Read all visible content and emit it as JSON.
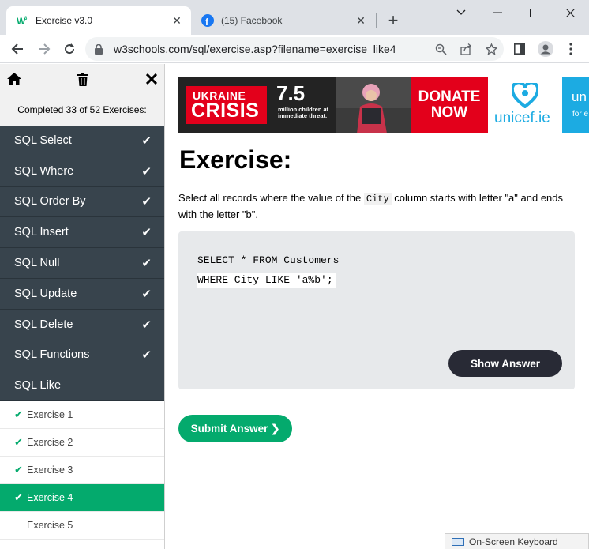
{
  "browser": {
    "tabs": [
      {
        "title": "Exercise v3.0",
        "favicon": "w3schools-icon",
        "active": true
      },
      {
        "title": "(15) Facebook",
        "favicon": "facebook-icon",
        "active": false
      }
    ],
    "url": "w3schools.com/sql/exercise.asp?filename=exercise_like4"
  },
  "sidebar": {
    "progress_text": "Completed 33 of 52 Exercises:",
    "sections": [
      {
        "label": "SQL Select",
        "completed": true
      },
      {
        "label": "SQL Where",
        "completed": true
      },
      {
        "label": "SQL Order By",
        "completed": true
      },
      {
        "label": "SQL Insert",
        "completed": true
      },
      {
        "label": "SQL Null",
        "completed": true
      },
      {
        "label": "SQL Update",
        "completed": true
      },
      {
        "label": "SQL Delete",
        "completed": true
      },
      {
        "label": "SQL Functions",
        "completed": true
      },
      {
        "label": "SQL Like",
        "completed": false
      }
    ],
    "exercises": [
      {
        "label": "Exercise 1",
        "completed": true
      },
      {
        "label": "Exercise 2",
        "completed": true
      },
      {
        "label": "Exercise 3",
        "completed": true
      },
      {
        "label": "Exercise 4",
        "completed": true,
        "active": true
      },
      {
        "label": "Exercise 5",
        "completed": false
      }
    ]
  },
  "banner": {
    "ukraine_line1": "UKRAINE",
    "ukraine_line2": "CRISIS",
    "number": "7.5",
    "small_text": "million children at immediate threat.",
    "donate_line1": "DONATE",
    "donate_line2": "NOW",
    "unicef": "unicef.ie",
    "blue_text1": "un",
    "blue_text2": "for e"
  },
  "main": {
    "heading": "Exercise:",
    "instruction_before": "Select all records where the value of the ",
    "instruction_code": "City",
    "instruction_after": " column starts with letter \"a\" and ends with the letter \"b\".",
    "code_line1": "SELECT * FROM Customers",
    "code_line2": "WHERE City LIKE 'a%b';",
    "show_answer": "Show Answer",
    "submit": "Submit Answer ❯"
  },
  "taskbar": {
    "osk_label": "On-Screen Keyboard"
  },
  "colors": {
    "accent_green": "#04aa6d",
    "sidebar_dark": "#38444d",
    "button_dark": "#282a35"
  }
}
